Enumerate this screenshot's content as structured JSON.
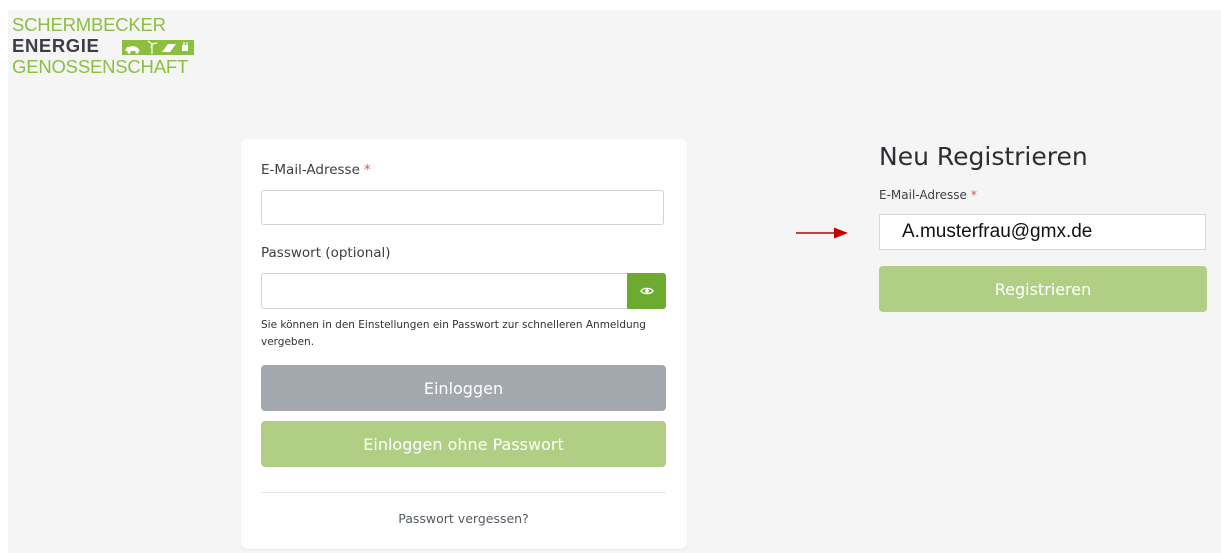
{
  "logo": {
    "line1": "SCHERMBECKER",
    "line2": "ENERGIE",
    "line3": "GENOSSENSCHAFT",
    "icon": "energy-icons-mark",
    "green": "#8cbf3f",
    "dark": "#3b3f45"
  },
  "login": {
    "email_label": "E-Mail-Adresse",
    "required_marker": "*",
    "email_value": "",
    "password_label": "Passwort (optional)",
    "password_value": "",
    "toggle_icon": "eye-icon",
    "hint": "Sie können in den Einstellungen ein Passwort zur schnelleren Anmeldung vergeben.",
    "login_button": "Einloggen",
    "login_no_password_button": "Einloggen ohne Passwort",
    "forgot_link": "Passwort vergessen?"
  },
  "register": {
    "title": "Neu Registrieren",
    "email_label": "E-Mail-Adresse",
    "required_marker": "*",
    "email_value": "A.musterfrau@gmx.de",
    "button": "Registrieren"
  },
  "annotation": {
    "icon": "arrow-right-icon",
    "color": "#c00000"
  },
  "colors": {
    "accent_green": "#6cab30",
    "button_green_light": "#b1cf84",
    "button_grey": "#a3a8ae",
    "required_red": "#d9534f"
  }
}
